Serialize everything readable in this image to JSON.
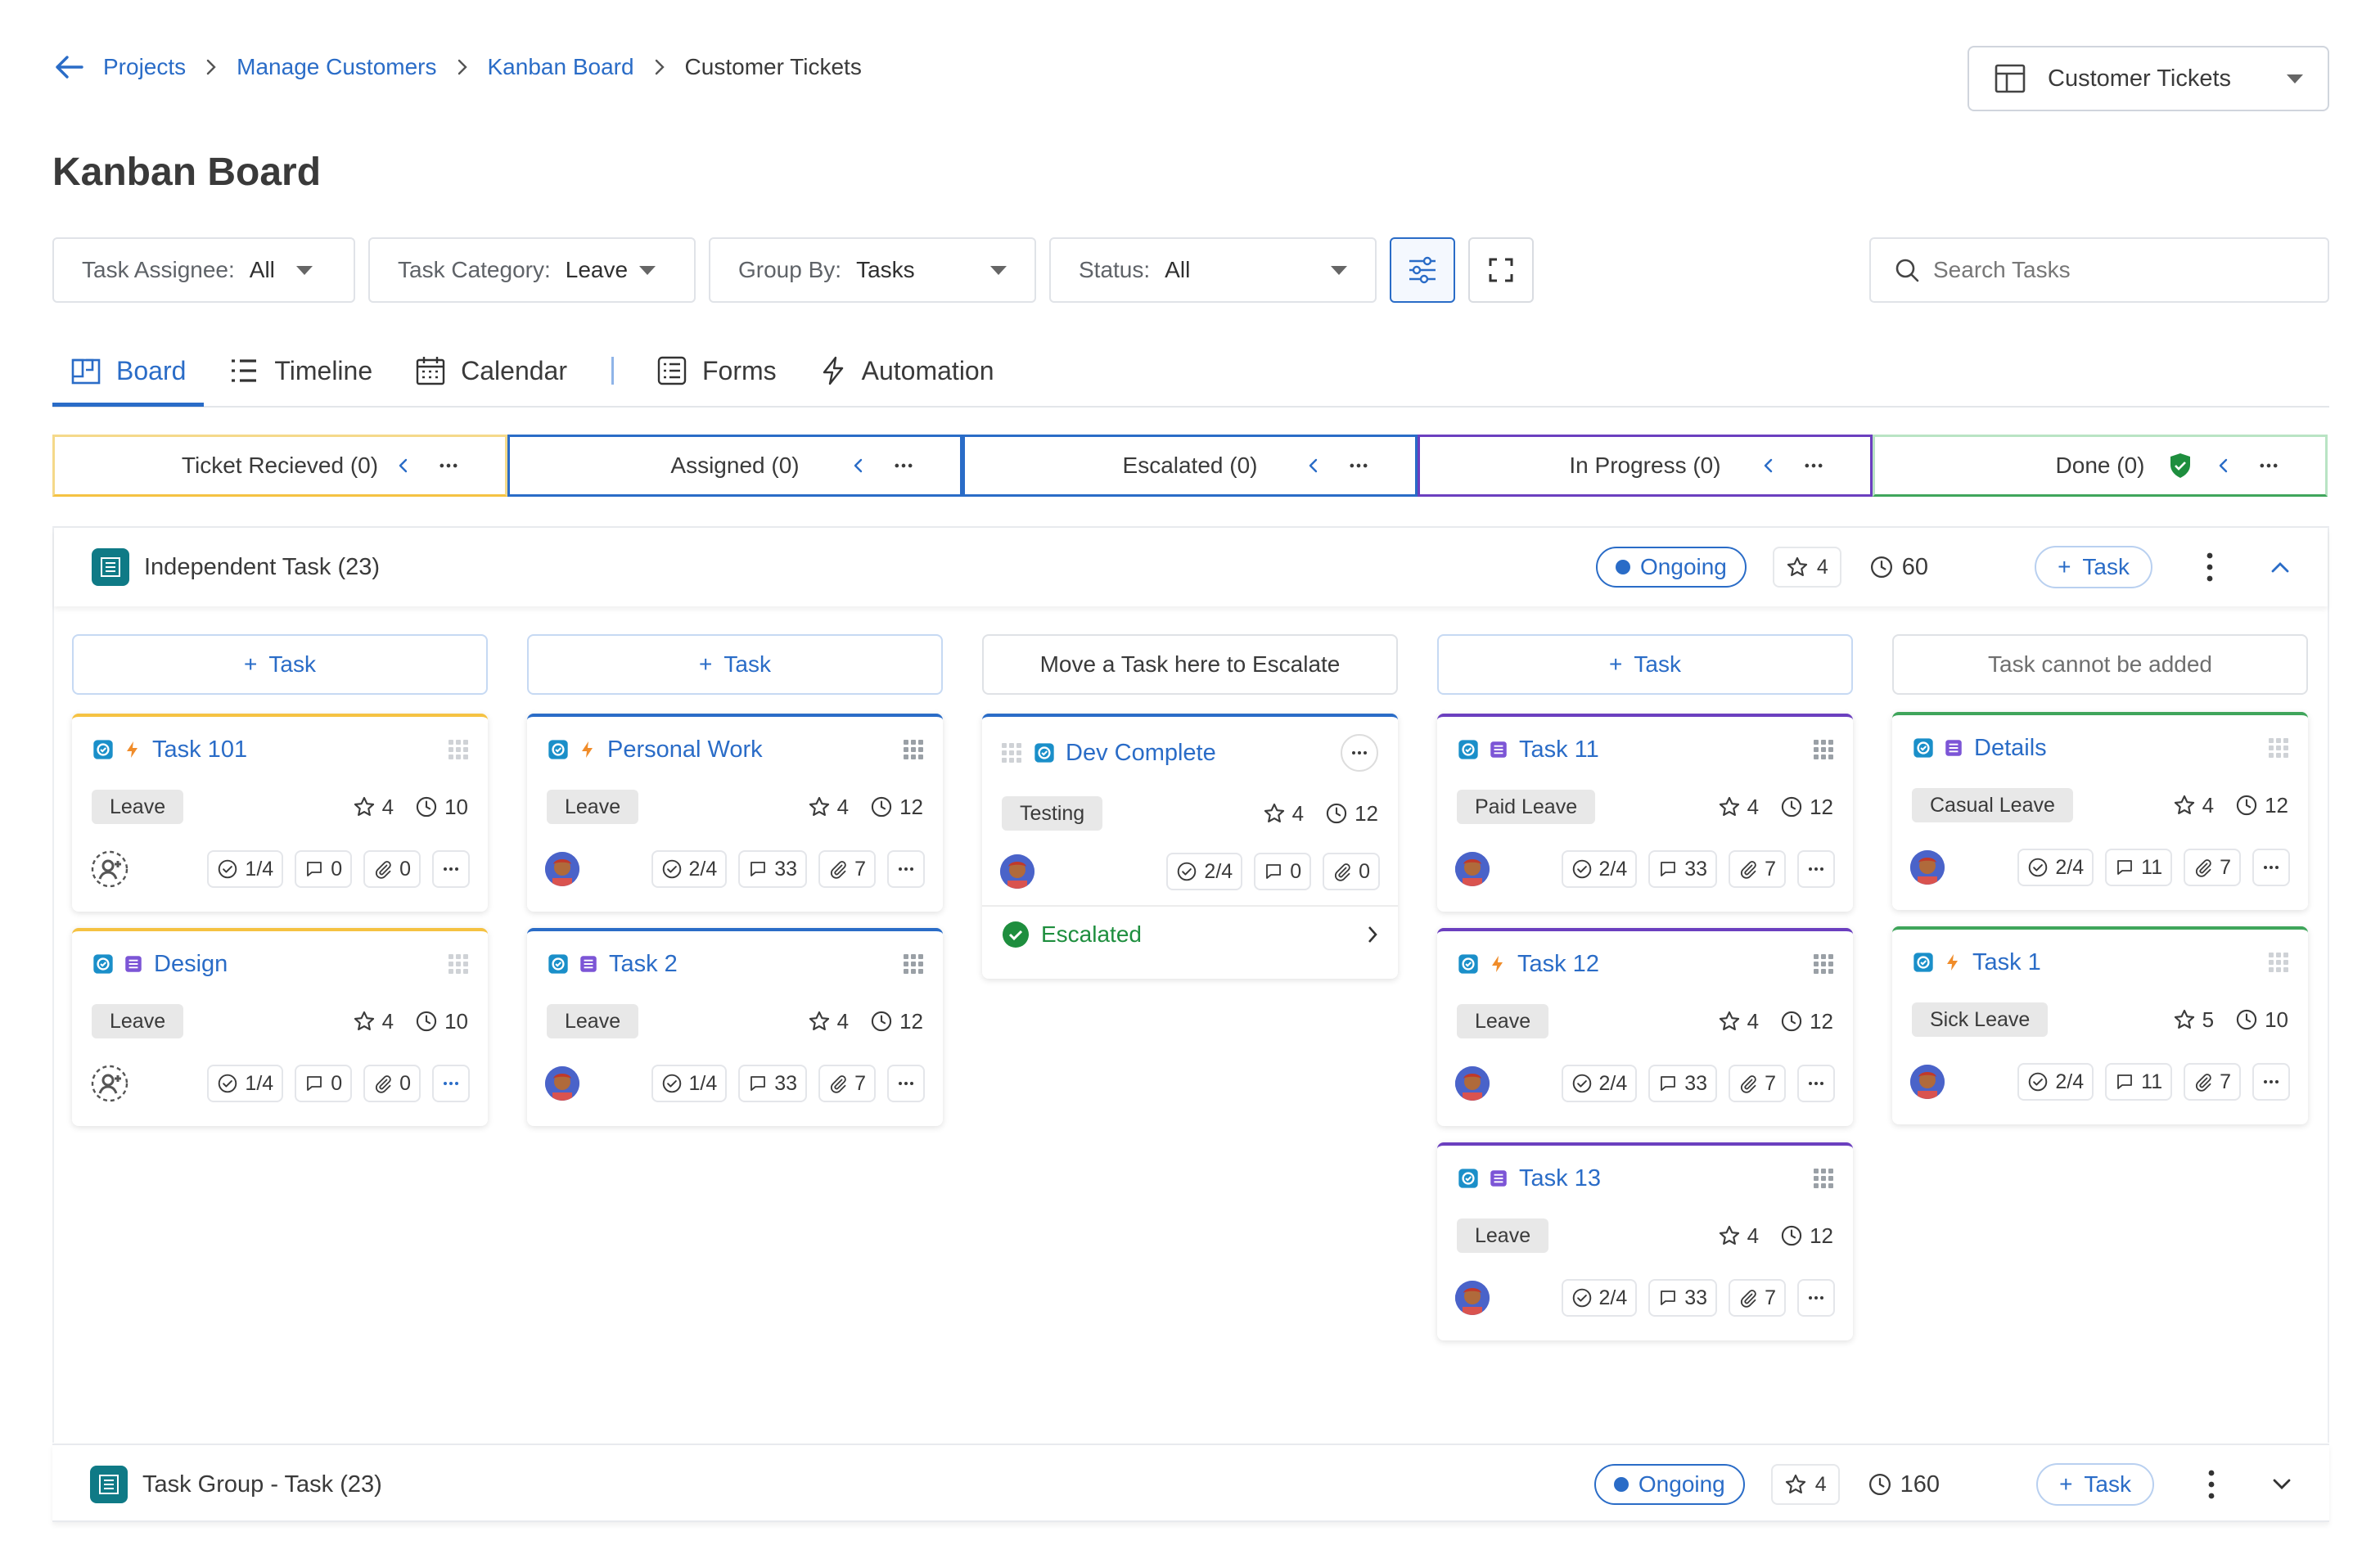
{
  "breadcrumb": {
    "items": [
      "Projects",
      "Manage Customers",
      "Kanban Board"
    ],
    "current": "Customer Tickets"
  },
  "view_selector": {
    "label": "Customer Tickets"
  },
  "page_title": "Kanban Board",
  "filters": [
    {
      "label": "Task Assignee:",
      "value": "All"
    },
    {
      "label": "Task Category:",
      "value": "Leave"
    },
    {
      "label": "Group By:",
      "value": "Tasks"
    },
    {
      "label": "Status:",
      "value": "All"
    }
  ],
  "search": {
    "placeholder": "Search Tasks"
  },
  "tabs": [
    {
      "label": "Board",
      "icon": "board-icon",
      "active": true
    },
    {
      "label": "Timeline",
      "icon": "list-icon"
    },
    {
      "label": "Calendar",
      "icon": "calendar-icon"
    },
    {
      "label": "Forms",
      "icon": "forms-icon"
    },
    {
      "label": "Automation",
      "icon": "bolt-icon"
    }
  ],
  "columns": [
    {
      "title": "Ticket Recieved (0)",
      "color": "#f5c242"
    },
    {
      "title": "Assigned (0)",
      "color": "#2a6cc7"
    },
    {
      "title": "Escalated (0)",
      "color": "#2a6cc7"
    },
    {
      "title": "In Progress (0)",
      "color": "#6b3fbf"
    },
    {
      "title": "Done (0)",
      "color": "#3fa55b"
    }
  ],
  "group1": {
    "title": "Independent Task (23)",
    "status": "Ongoing",
    "stars": "4",
    "time": "60",
    "add_label": "Task"
  },
  "group2": {
    "title": "Task Group - Task (23)",
    "status": "Ongoing",
    "stars": "4",
    "time": "160",
    "add_label": "Task"
  },
  "add_rows": [
    "Task",
    "Task",
    "Move a Task here to Escalate",
    "Task",
    "Task cannot be added"
  ],
  "cards": {
    "c1a": {
      "name": "Task 101",
      "tag": "Leave",
      "stars": "4",
      "time": "10",
      "checks": "1/4",
      "comments": "0",
      "attach": "0"
    },
    "c1b": {
      "name": "Design",
      "tag": "Leave",
      "stars": "4",
      "time": "10",
      "checks": "1/4",
      "comments": "0",
      "attach": "0"
    },
    "c2a": {
      "name": "Personal Work",
      "tag": "Leave",
      "stars": "4",
      "time": "12",
      "checks": "2/4",
      "comments": "33",
      "attach": "7"
    },
    "c2b": {
      "name": "Task 2",
      "tag": "Leave",
      "stars": "4",
      "time": "12",
      "checks": "1/4",
      "comments": "33",
      "attach": "7"
    },
    "c3a": {
      "name": "Dev Complete",
      "tag": "Testing",
      "stars": "4",
      "time": "12",
      "checks": "2/4",
      "comments": "0",
      "attach": "0",
      "status": "Escalated"
    },
    "c4a": {
      "name": "Task 11",
      "tag": "Paid Leave",
      "stars": "4",
      "time": "12",
      "checks": "2/4",
      "comments": "33",
      "attach": "7"
    },
    "c4b": {
      "name": "Task 12",
      "tag": "Leave",
      "stars": "4",
      "time": "12",
      "checks": "2/4",
      "comments": "33",
      "attach": "7"
    },
    "c4c": {
      "name": "Task 13",
      "tag": "Leave",
      "stars": "4",
      "time": "12",
      "checks": "2/4",
      "comments": "33",
      "attach": "7"
    },
    "c5a": {
      "name": "Details",
      "tag": "Casual Leave",
      "stars": "4",
      "time": "12",
      "checks": "2/4",
      "comments": "11",
      "attach": "7"
    },
    "c5b": {
      "name": "Task 1",
      "tag": "Sick Leave",
      "stars": "5",
      "time": "10",
      "checks": "2/4",
      "comments": "11",
      "attach": "7"
    }
  },
  "colors": {
    "accent": "#2a6cc7",
    "success": "#1e8e3e",
    "progress": "#6b3fbf",
    "done": "#3fa55b",
    "received": "#f5c242"
  }
}
